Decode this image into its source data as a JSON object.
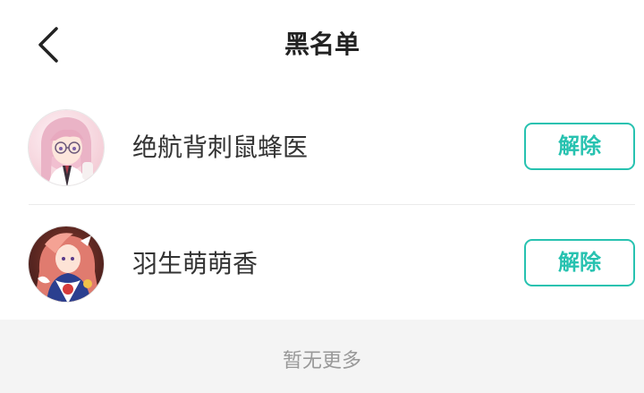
{
  "header": {
    "title": "黑名单",
    "back_icon": "chevron-left-icon"
  },
  "blacklist": {
    "items": [
      {
        "name": "绝航背刺鼠蜂医",
        "action_label": "解除",
        "avatar": "avatar-pink-hair-glasses"
      },
      {
        "name": "羽生萌萌香",
        "action_label": "解除",
        "avatar": "avatar-red-hair-costume"
      }
    ]
  },
  "footer": {
    "text": "暂无更多"
  },
  "colors": {
    "accent": "#27c2b0",
    "title": "#222222",
    "name": "#333333",
    "muted": "#999999",
    "footer_bg": "#f4f4f4"
  }
}
